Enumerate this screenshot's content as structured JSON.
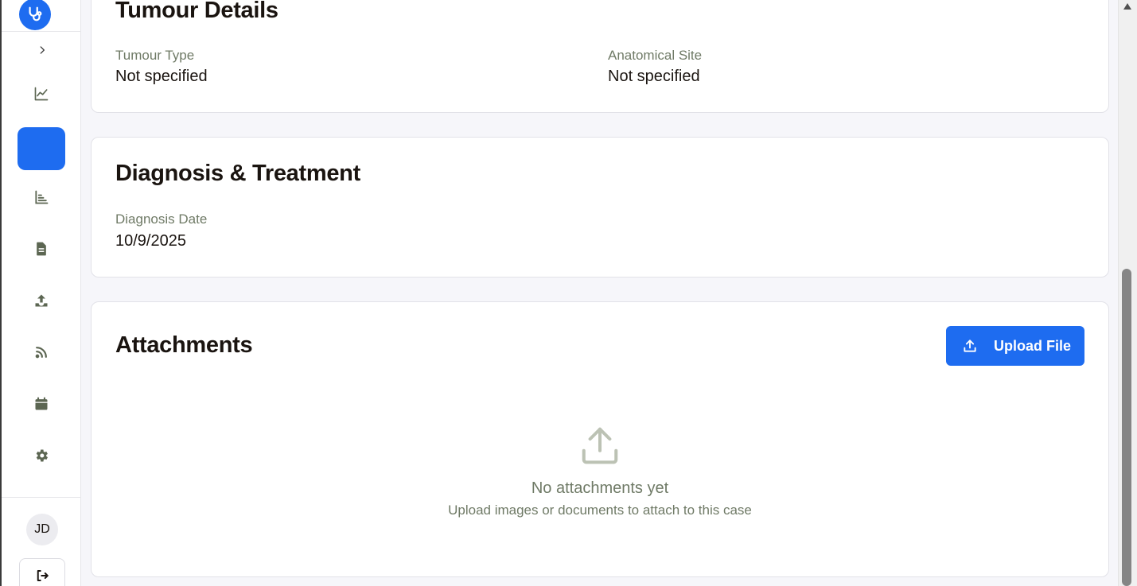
{
  "sidebar": {
    "logo_icon": "stethoscope-icon",
    "expand_icon": "chevron-right-icon",
    "nav": [
      {
        "icon": "line-chart-icon"
      },
      {
        "icon": "active-blank",
        "active": true
      },
      {
        "icon": "bar-chart-icon"
      },
      {
        "icon": "document-icon"
      },
      {
        "icon": "upload-icon"
      },
      {
        "icon": "rss-feed-icon"
      },
      {
        "icon": "calendar-icon"
      },
      {
        "icon": "gear-icon"
      }
    ],
    "avatar_initials": "JD",
    "logout_icon": "logout-icon"
  },
  "tumour_details": {
    "title": "Tumour Details",
    "tumour_type_label": "Tumour Type",
    "tumour_type_value": "Not specified",
    "anatomical_site_label": "Anatomical Site",
    "anatomical_site_value": "Not specified"
  },
  "diagnosis": {
    "title": "Diagnosis & Treatment",
    "date_label": "Diagnosis Date",
    "date_value": "10/9/2025"
  },
  "attachments": {
    "title": "Attachments",
    "upload_button": "Upload File",
    "empty_title": "No attachments yet",
    "empty_subtitle": "Upload images or documents to attach to this case"
  },
  "colors": {
    "accent": "#1e6cf0",
    "icon_muted": "#6f7a66",
    "text": "#1a1410"
  }
}
